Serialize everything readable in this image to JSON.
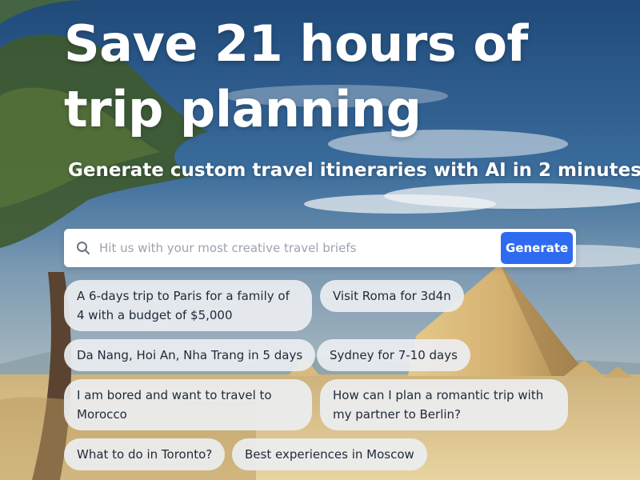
{
  "hero": {
    "title": "Save 21 hours of trip planning",
    "subtitle": "Generate custom travel itineraries with AI in 2 minutes"
  },
  "search": {
    "icon": "search-icon",
    "placeholder": "Hit us with your most creative travel briefs",
    "value": "",
    "button_label": "Generate",
    "button_color": "#2f6bf0"
  },
  "suggestions": [
    "A 6-days trip to Paris for a family of 4 with a budget of $5,000",
    "Visit Roma for 3d4n",
    "Da Nang, Hoi An, Nha Trang in 5 days",
    "Sydney for 7-10 days",
    "I am bored and want to travel to Morocco",
    "How can I plan a romantic trip with my partner to Berlin?",
    "What to do in Toronto?",
    "Best experiences in Moscow"
  ]
}
